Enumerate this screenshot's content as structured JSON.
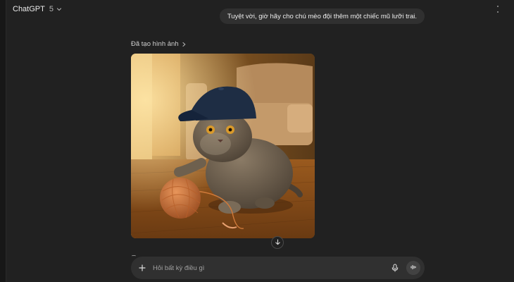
{
  "header": {
    "model_name": "ChatGPT",
    "model_version": "5"
  },
  "conversation": {
    "user_message": "Tuyệt vời, giờ hãy cho chú mèo đội thêm một chiếc mũ lưỡi trai.",
    "assistant": {
      "image_label": "Đã tạo hình ảnh"
    }
  },
  "composer": {
    "placeholder": "Hỏi bất kỳ điều gì"
  },
  "icons": {
    "model_chevron": "chevron-down-icon",
    "image_label_chevron": "chevron-right-icon",
    "scroll_down": "arrow-down-icon",
    "add": "plus-icon",
    "mic": "microphone-icon",
    "voice": "voice-waveform-icon"
  },
  "colors": {
    "background": "#212121",
    "bubble": "#303030",
    "text": "#ececec"
  }
}
